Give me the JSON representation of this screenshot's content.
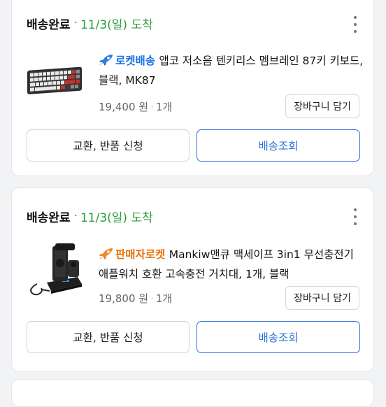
{
  "orders": [
    {
      "status": "배송완료",
      "dot": "·",
      "date": "11/3(일) 도착",
      "badge": "로켓배송",
      "product": "앱코 저소음 텐키리스 멤브레인 87키 키보드, 블랙, MK87",
      "price": "19,400 원",
      "qty": "1개",
      "cart_label": "장바구니 담기",
      "exchange_label": "교환, 반품 신청",
      "track_label": "배송조회"
    },
    {
      "status": "배송완료",
      "dot": "·",
      "date": "11/3(일) 도착",
      "badge": "판매자로켓",
      "product": "Mankiw맨큐 맥세이프 3in1 무선충전기 애플워치 호환 고속충전 거치대, 1개, 블랙",
      "price": "19,800 원",
      "qty": "1개",
      "cart_label": "장바구니 담기",
      "exchange_label": "교환, 반품 신청",
      "track_label": "배송조회"
    }
  ],
  "separator": "·",
  "colors": {
    "status_green": "#2c9d3d",
    "rocket_blue": "#1a73e8",
    "seller_orange": "#e8710a",
    "track_blue": "#2f6fd8"
  },
  "icons": {
    "more": "more-vertical-icon",
    "rocket": "rocket-icon"
  }
}
